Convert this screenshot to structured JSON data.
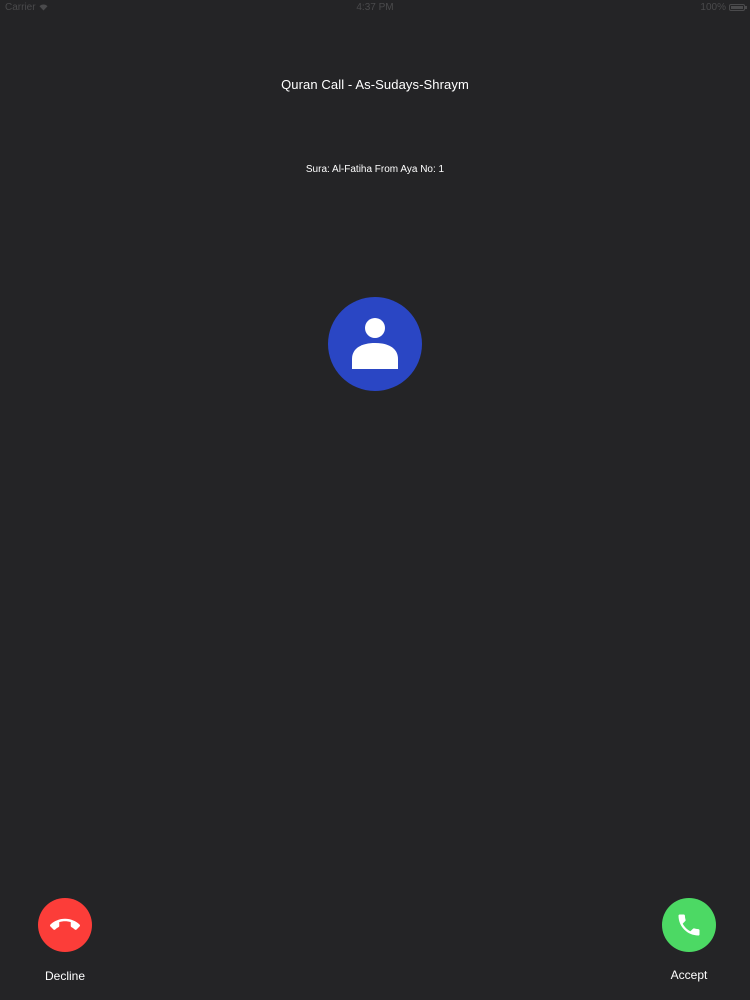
{
  "status_bar": {
    "carrier": "Carrier",
    "time": "4:37 PM",
    "battery": "100%",
    "wifi_icon": "wifi-icon",
    "battery_icon": "battery-icon"
  },
  "call": {
    "title": "Quran Call - As-Sudays-Shraym",
    "subtitle": "Sura: Al-Fatiha From Aya No: 1",
    "avatar_icon": "person-icon"
  },
  "actions": {
    "decline_label": "Decline",
    "accept_label": "Accept",
    "decline_icon": "hang-up-phone-icon",
    "accept_icon": "phone-icon"
  },
  "colors": {
    "background": "#242426",
    "avatar": "#2a46c4",
    "decline": "#fc3d39",
    "accept": "#4cd964"
  }
}
